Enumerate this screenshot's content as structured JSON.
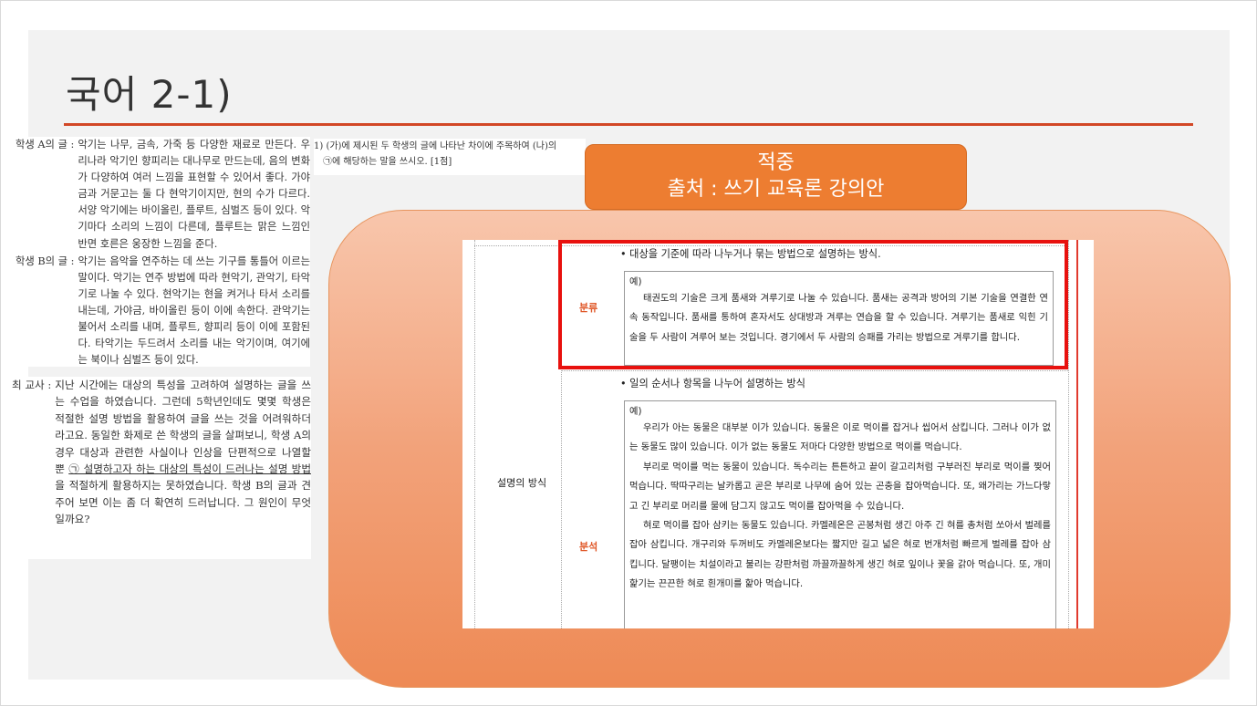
{
  "slide": {
    "title": "국어 2-1)"
  },
  "passage_a": {
    "label": "학생 A의 글 :",
    "text": "악기는 나무, 금속, 가죽 등 다양한 재료로 만든다. 우리나라 악기인 향피리는 대나무로 만드는데, 음의 변화가 다양하여 여러 느낌을 표현할 수 있어서 좋다. 가야금과 거문고는 둘 다 현악기이지만, 현의 수가 다르다. 서양 악기에는 바이올린, 플루트, 심벌즈 등이 있다. 악기마다 소리의 느낌이 다른데, 플루트는 맑은 느낌인 반면 호른은 웅장한 느낌을 준다."
  },
  "passage_b": {
    "label": "학생 B의 글 :",
    "text": "악기는 음악을 연주하는 데 쓰는 기구를 통틀어 이르는 말이다. 악기는 연주 방법에 따라 현악기, 관악기, 타악기로 나눌 수 있다. 현악기는 현을 켜거나 타서 소리를 내는데, 가야금, 바이올린 등이 이에 속한다. 관악기는 불어서 소리를 내며, 플루트, 향피리 등이 이에 포함된다. 타악기는 두드려서 소리를 내는 악기이며, 여기에는 북이나 심벌즈 등이 있다."
  },
  "teacher": {
    "label": "최 교사 :",
    "text_before": "지난 시간에는 대상의 특성을 고려하여 설명하는 글을 쓰는 수업을 하였습니다. 그런데 5학년인데도 몇몇 학생은 적절한 설명 방법을 활용하여 글을 쓰는 것을 어려워하더라고요. 동일한 화제로 쓴 학생의 글을 살펴보니, 학생 A의 경우 대상과 관련한 사실이나 인상을 단편적으로 나열할 뿐 ",
    "underlined": "㉠ 설명하고자 하는 대상의 특성이 드러나는 설명 방법",
    "text_after": "을 적절하게 활용하지는 못하였습니다. 학생 B의 글과 견주어 보면 이는 좀 더 확연히 드러납니다. 그 원인이 무엇일까요?"
  },
  "question": {
    "line1": "1) (가)에 제시된 두 학생의 글에 나타난 차이에 주목하여 (나)의",
    "line2": "㉠에 해당하는 말을 쓰시오. [1점]"
  },
  "callout": {
    "line1": "적중",
    "line2": "출처 : 쓰기 교육론 강의안"
  },
  "doc": {
    "section_label": "설명의 방식",
    "rows": [
      {
        "category": "분류",
        "bullet": "•  대상을 기준에 따라 나누거나 묶는 방법으로 설명하는 방식.",
        "example_label": "예)",
        "example_paras": [
          "태권도의 기술은 크게 품새와 겨루기로 나눌 수 있습니다. 품새는 공격과 방어의 기본 기술을 연결한 연속 동작입니다. 품새를 통하여 혼자서도 상대방과 겨루는 연습을 할 수 있습니다. 겨루기는 품새로 익힌 기술을 두 사람이 겨루어 보는 것입니다. 경기에서 두 사람의 승패를 가리는 방법으로 겨루기를 합니다."
        ]
      },
      {
        "category": "분석",
        "bullet": "•  일의 순서나 항목을 나누어 설명하는 방식",
        "example_label": "예)",
        "example_paras": [
          "우리가 아는 동물은 대부분 이가 있습니다. 동물은 이로 먹이를 잡거나 씹어서 삼킵니다. 그러나 이가 없는 동물도 많이 있습니다. 이가 없는 동물도 저마다 다양한 방법으로 먹이를 먹습니다.",
          "부리로 먹이를 먹는 동물이 있습니다. 독수리는 튼튼하고 끝이 갈고리처럼 구부러진 부리로 먹이를 찢어 먹습니다. 딱따구리는 날카롭고 곧은 부리로 나무에 숨어 있는 곤충을 잡아먹습니다. 또, 왜가리는 가느다랗고 긴 부리로 머리를 물에 담그지 않고도 먹이를 잡아먹을 수 있습니다.",
          "혀로 먹이를 잡아 삼키는 동물도 있습니다. 카멜레온은 곤봉처럼 생긴 아주 긴 혀를 총처럼 쏘아서 벌레를 잡아 삼킵니다. 개구리와 두꺼비도 카멜레온보다는 짧지만 길고 넓은 혀로 번개처럼 빠르게 벌레를 잡아 삼킵니다. 달팽이는 치설이라고 불리는 강판처럼 까끌까끌하게 생긴 혀로 잎이나 꽃을 갉아 먹습니다. 또, 개미핥기는 끈끈한 혀로 흰개미를 핥아 먹습니다."
        ]
      }
    ]
  },
  "colors": {
    "accent_rule": "#d24726",
    "callout_fill": "#ed7d31",
    "highlight_box": "#e8110e",
    "category_text": "#e0592a"
  }
}
